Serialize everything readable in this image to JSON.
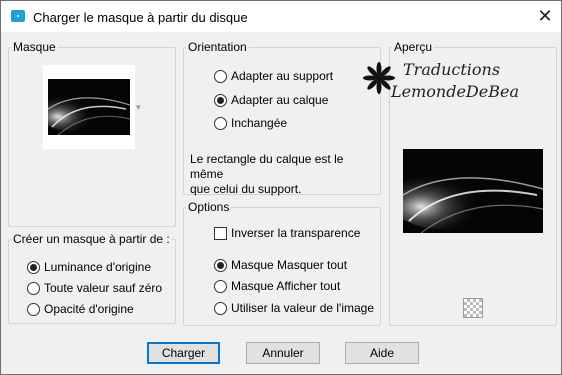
{
  "window": {
    "title": "Charger le masque à partir du disque",
    "close_label": "✕"
  },
  "mask_group": {
    "legend": "Masque"
  },
  "create_group": {
    "legend": "Créer un masque à partir de :",
    "options": [
      {
        "label": "Luminance d'origine",
        "selected": true
      },
      {
        "label": "Toute valeur sauf zéro",
        "selected": false
      },
      {
        "label": "Opacité d'origine",
        "selected": false
      }
    ]
  },
  "orientation_group": {
    "legend": "Orientation",
    "options": [
      {
        "label": "Adapter au support",
        "selected": false
      },
      {
        "label": "Adapter au calque",
        "selected": true
      },
      {
        "label": "Inchangée",
        "selected": false
      }
    ],
    "info_line1": "Le rectangle du calque est le même",
    "info_line2": "que celui du support."
  },
  "options_group": {
    "legend": "Options",
    "invert_label": "Inverser la transparence",
    "invert_checked": false,
    "options": [
      {
        "label": "Masque Masquer tout",
        "selected": true
      },
      {
        "label": "Masque Afficher tout",
        "selected": false
      },
      {
        "label": "Utiliser la valeur de l'image",
        "selected": false
      }
    ]
  },
  "preview_group": {
    "legend": "Aperçu"
  },
  "watermark": {
    "line1": "Traductions",
    "line2": "LemondeDeBea"
  },
  "buttons": {
    "load": "Charger",
    "cancel": "Annuler",
    "help": "Aide"
  },
  "icons": {
    "title": "camera-icon",
    "close": "close-icon",
    "dropdown": "chevron-down-icon",
    "transparency": "checkerboard-icon",
    "watermark": "flower-icon"
  },
  "colors": {
    "title_icon": "#1aa0d4",
    "default_button_border": "#0078d7",
    "dialog_bg": "#f0f0f0"
  }
}
